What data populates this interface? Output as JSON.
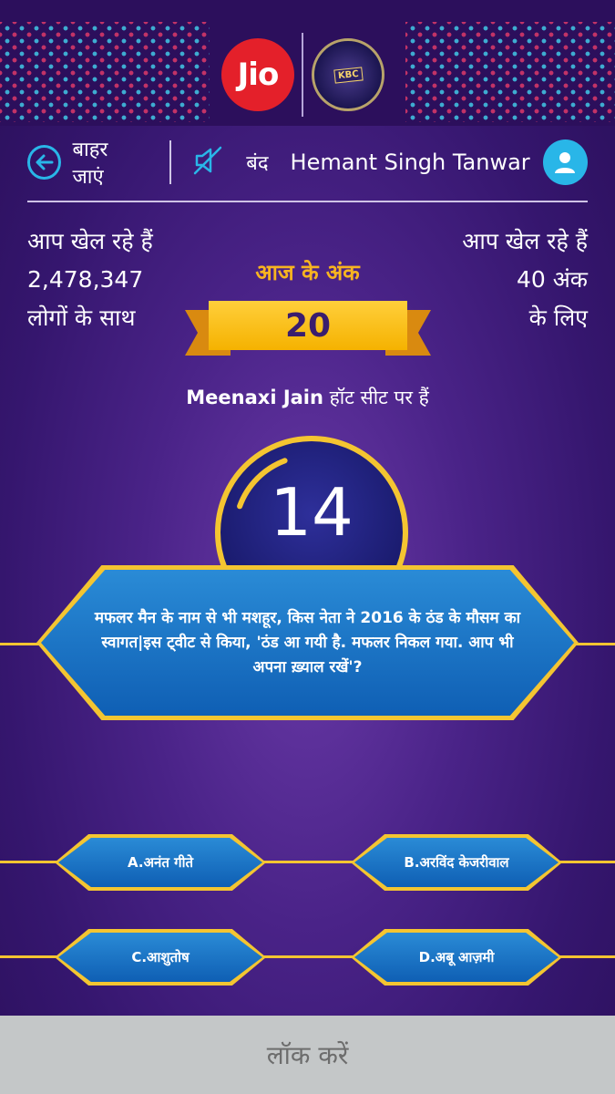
{
  "header": {
    "brand_logo": "Jio",
    "exit_label": "बाहर जाएं",
    "sound_label": "बंद",
    "user_name": "Hemant Singh Tanwar",
    "icons": [
      "back-arrow-icon",
      "speaker-muted-icon",
      "user-avatar-icon"
    ]
  },
  "stats": {
    "players_line1": "आप खेल रहे हैं",
    "players_count": "2,478,347",
    "players_line3": "लोगों के साथ",
    "points_line1": "आप खेल रहे हैं",
    "points_value": "40 अंक",
    "points_line3": "के लिए"
  },
  "today": {
    "label": "आज के अंक",
    "score": "20"
  },
  "hotseat": {
    "name": "Meenaxi Jain",
    "suffix": " हॉट सीट पर हैं"
  },
  "timer": {
    "seconds": "14",
    "remaining_fraction": 0.25
  },
  "question": {
    "text": "मफलर मैन के नाम से भी मशहूर, किस नेता ने 2016 के ठंड के मौसम का स्वागत|इस ट्वीट से किया, 'ठंड आ गयी है. मफलर निकल गया. आप भी अपना ख़्याल रखें'?"
  },
  "options": [
    {
      "label": "A.अनंत गीते"
    },
    {
      "label": "B.अरविंद केजरीवाल"
    },
    {
      "label": "C.आशुतोष"
    },
    {
      "label": "D.अबू आज़मी"
    }
  ],
  "lock_label": "लॉक करें",
  "colors": {
    "accent_gold": "#f4c531",
    "answer_blue": "#1a74c8",
    "icon_cyan": "#29b6e8",
    "jio_red": "#e4202a"
  }
}
